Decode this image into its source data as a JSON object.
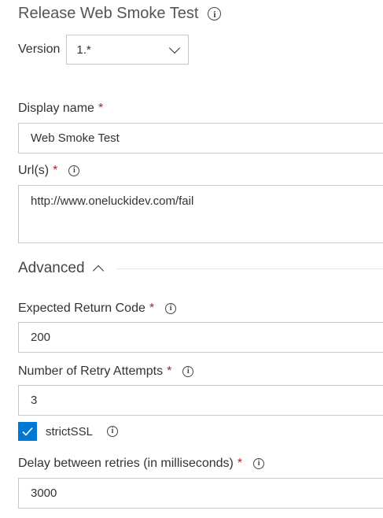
{
  "header": {
    "title": "Release Web Smoke Test",
    "info_icon": "ⓘ"
  },
  "version": {
    "label": "Version",
    "selected": "1.*"
  },
  "fields": {
    "display_name": {
      "label": "Display name",
      "required": "*",
      "value": "Web Smoke Test"
    },
    "urls": {
      "label": "Url(s)",
      "required": "*",
      "value": "http://www.oneluckidev.com/fail"
    },
    "expected_return_code": {
      "label": "Expected Return Code",
      "required": "*",
      "value": "200"
    },
    "retry_attempts": {
      "label": "Number of Retry Attempts",
      "required": "*",
      "value": "3"
    },
    "delay": {
      "label": "Delay between retries (in milliseconds)",
      "required": "*",
      "value": "3000"
    }
  },
  "advanced": {
    "label": "Advanced",
    "expanded": true
  },
  "strict_ssl": {
    "label": "strictSSL",
    "checked": true
  },
  "colors": {
    "accent": "#0078d4",
    "required": "#a4262c",
    "border": "#c8c8c8"
  },
  "icons": [
    "info-icon",
    "chevron-down-icon",
    "chevron-up-icon",
    "checkmark-icon"
  ]
}
